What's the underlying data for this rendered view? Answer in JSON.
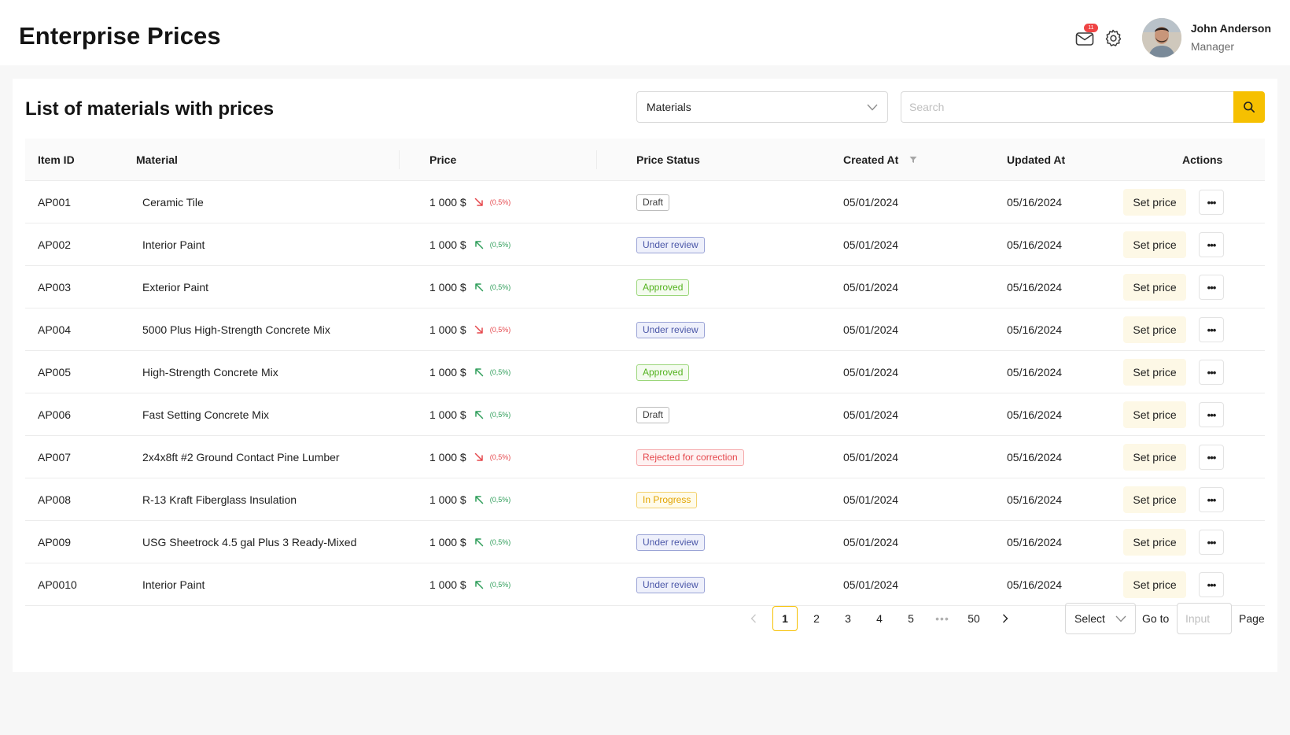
{
  "header": {
    "title": "Enterprise Prices",
    "notifications_count": "11",
    "user": {
      "name": "John Anderson",
      "role": "Manager"
    }
  },
  "card": {
    "title": "List of materials with prices",
    "category_select": {
      "value": "Materials"
    },
    "search": {
      "placeholder": "Search"
    }
  },
  "table": {
    "columns": {
      "item_id": "Item ID",
      "material": "Material",
      "price": "Price",
      "price_status": "Price Status",
      "created_at": "Created At",
      "updated_at": "Updated At",
      "actions": "Actions"
    },
    "rows": [
      {
        "id": "AP001",
        "material": "Ceramic Tile",
        "price": "1 000 $",
        "trend": "down",
        "change": "(0,5%)",
        "status": "Draft",
        "status_kind": "draft",
        "created": "05/01/2024",
        "updated": "05/16/2024",
        "action": "Set price"
      },
      {
        "id": "AP002",
        "material": "Interior Paint",
        "price": "1 000 $",
        "trend": "up",
        "change": "(0,5%)",
        "status": "Under review",
        "status_kind": "review",
        "created": "05/01/2024",
        "updated": "05/16/2024",
        "action": "Set price"
      },
      {
        "id": "AP003",
        "material": "Exterior Paint",
        "price": "1 000 $",
        "trend": "up",
        "change": "(0,5%)",
        "status": "Approved",
        "status_kind": "approved",
        "created": "05/01/2024",
        "updated": "05/16/2024",
        "action": "Set price"
      },
      {
        "id": "AP004",
        "material": "5000 Plus High-Strength Concrete Mix",
        "price": "1 000 $",
        "trend": "down",
        "change": "(0,5%)",
        "status": "Under review",
        "status_kind": "review",
        "created": "05/01/2024",
        "updated": "05/16/2024",
        "action": "Set price"
      },
      {
        "id": "AP005",
        "material": "High-Strength Concrete Mix",
        "price": "1 000 $",
        "trend": "up",
        "change": "(0,5%)",
        "status": "Approved",
        "status_kind": "approved",
        "created": "05/01/2024",
        "updated": "05/16/2024",
        "action": "Set price"
      },
      {
        "id": "AP006",
        "material": "Fast Setting Concrete Mix",
        "price": "1 000 $",
        "trend": "up",
        "change": "(0,5%)",
        "status": "Draft",
        "status_kind": "draft",
        "created": "05/01/2024",
        "updated": "05/16/2024",
        "action": "Set price"
      },
      {
        "id": "AP007",
        "material": "2x4x8ft #2 Ground Contact Pine Lumber",
        "price": "1 000 $",
        "trend": "down",
        "change": "(0,5%)",
        "status": "Rejected for correction",
        "status_kind": "rejected",
        "created": "05/01/2024",
        "updated": "05/16/2024",
        "action": "Set price"
      },
      {
        "id": "AP008",
        "material": "R-13 Kraft Fiberglass Insulation",
        "price": "1 000 $",
        "trend": "up",
        "change": "(0,5%)",
        "status": "In Progress",
        "status_kind": "progress",
        "created": "05/01/2024",
        "updated": "05/16/2024",
        "action": "Set price"
      },
      {
        "id": "AP009",
        "material": "USG Sheetrock 4.5 gal Plus 3 Ready-Mixed",
        "price": "1 000 $",
        "trend": "up",
        "change": "(0,5%)",
        "status": "Under review",
        "status_kind": "review",
        "created": "05/01/2024",
        "updated": "05/16/2024",
        "action": "Set price"
      },
      {
        "id": "AP0010",
        "material": "Interior Paint",
        "price": "1 000 $",
        "trend": "up",
        "change": "(0,5%)",
        "status": "Under review",
        "status_kind": "review",
        "created": "05/01/2024",
        "updated": "05/16/2024",
        "action": "Set price"
      }
    ]
  },
  "pagination": {
    "pages": [
      "1",
      "2",
      "3",
      "4",
      "5"
    ],
    "current": "1",
    "ellipsis": "•••",
    "last": "50",
    "size_select": "Select",
    "goto_label": "Go to",
    "goto_placeholder": "Input",
    "page_label": "Page"
  },
  "colors": {
    "accent": "#f6c000",
    "trend_up": "#2f9e5a",
    "trend_down": "#e5484d",
    "notification_badge": "#ef4444"
  }
}
